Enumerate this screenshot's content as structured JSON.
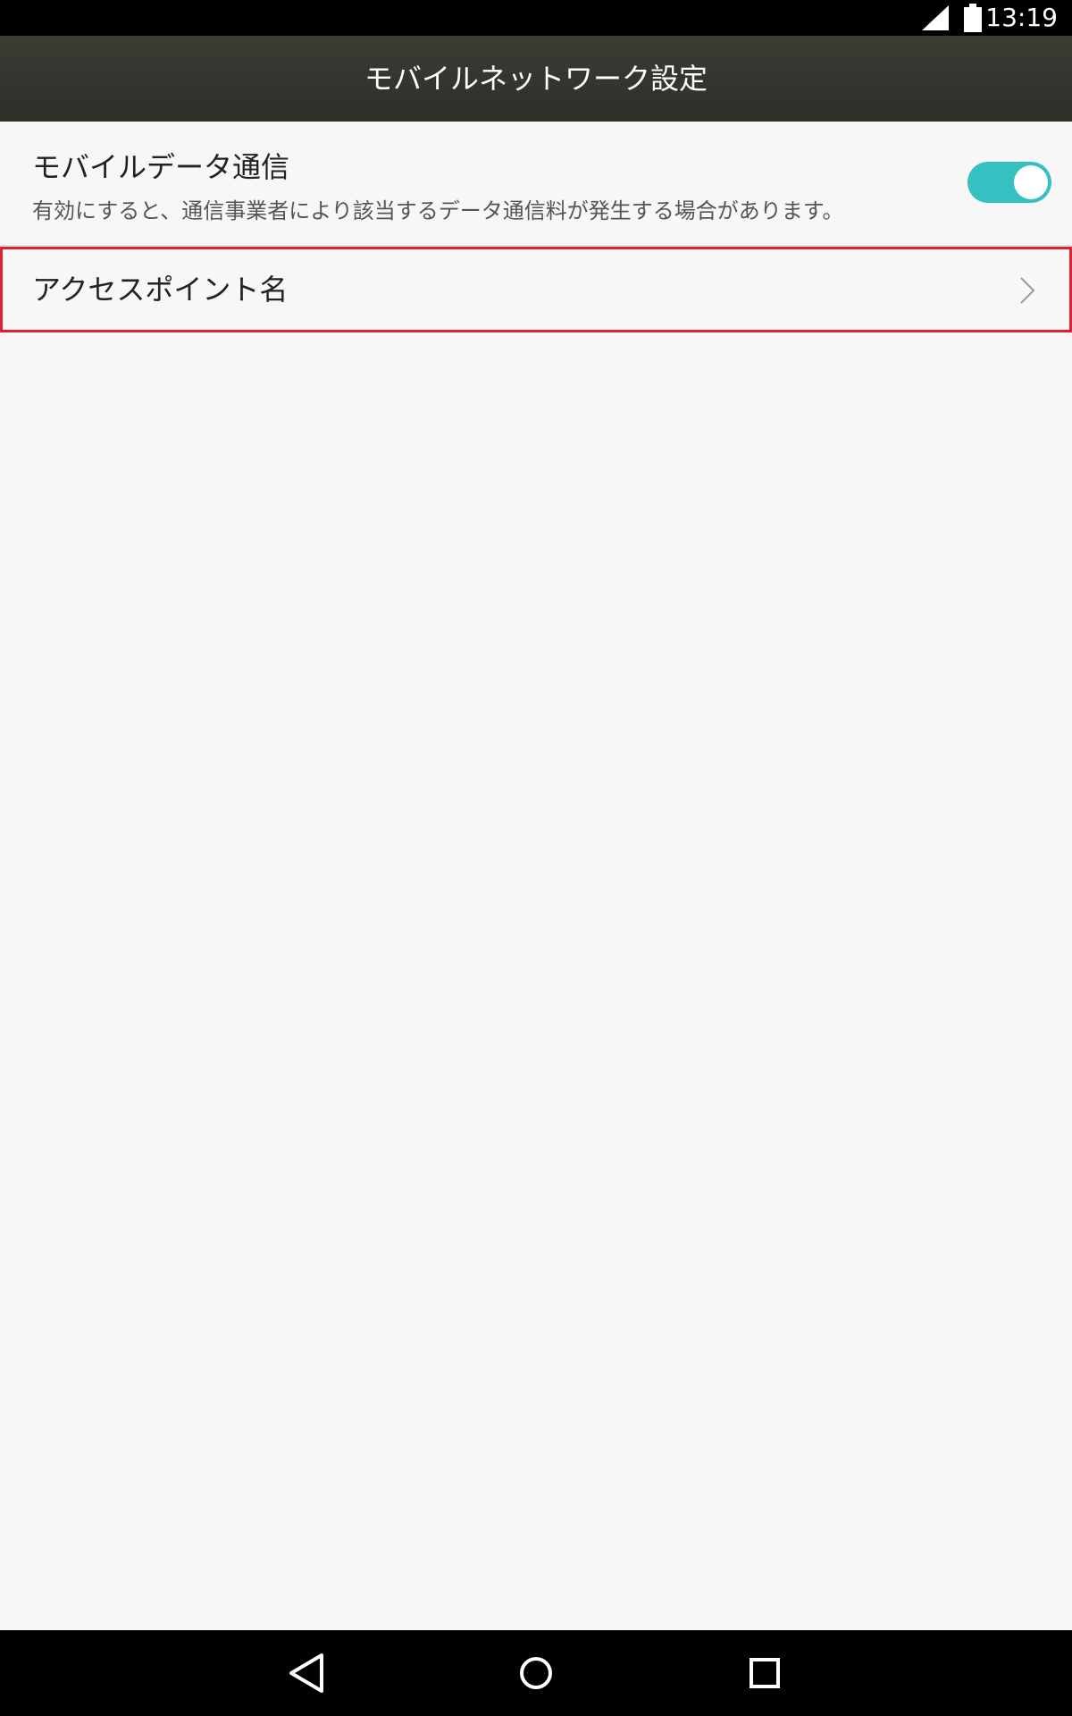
{
  "status_bar": {
    "time": "13:19",
    "icons": [
      "signal-icon",
      "battery-icon"
    ]
  },
  "app_bar": {
    "title": "モバイルネットワーク設定"
  },
  "settings": {
    "mobile_data": {
      "title": "モバイルデータ通信",
      "subtitle": "有効にすると、通信事業者により該当するデータ通信料が発生する場合があります。",
      "enabled": true
    },
    "access_point": {
      "title": "アクセスポイント名",
      "icon": "chevron-right-icon"
    }
  },
  "nav_bar": {
    "icons": [
      "back-icon",
      "home-icon",
      "recents-icon"
    ]
  },
  "colors": {
    "accent": "#35c1c1",
    "highlight_border": "#e02030",
    "app_bar": "#33352e",
    "background": "#f7f7f7"
  }
}
